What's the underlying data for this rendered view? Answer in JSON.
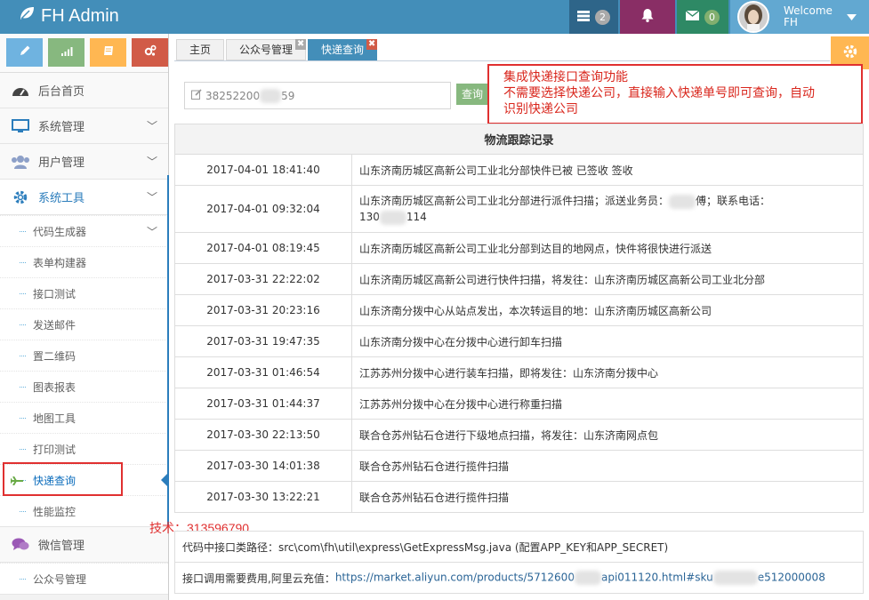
{
  "app": {
    "title": "FH Admin"
  },
  "navbar": {
    "tasks_count": "2",
    "messages_count": "0",
    "welcome_label": "Welcome",
    "user_name": "FH"
  },
  "colors": {
    "navbar": "#438eb9",
    "sidebar_active": "#2b7dbc",
    "annotation_red": "#e03030"
  },
  "sidebar": {
    "shortcuts": [
      "pencil-icon",
      "signal-icon",
      "book-icon",
      "cogs-icon"
    ],
    "menu": [
      {
        "label": "后台首页",
        "icon": "tachometer-icon"
      },
      {
        "label": "系统管理",
        "icon": "desktop-icon"
      },
      {
        "label": "用户管理",
        "icon": "users-icon"
      },
      {
        "label": "系统工具",
        "icon": "cog-icon"
      }
    ],
    "tools": [
      "代码生成器",
      "表单构建器",
      "接口测试",
      "发送邮件",
      "置二维码",
      "图表报表",
      "地图工具",
      "打印测试",
      "快递查询",
      "性能监控"
    ],
    "wechat": {
      "label": "微信管理",
      "icon": "comments-icon"
    },
    "wechat_sub": [
      "公众号管理"
    ]
  },
  "tabs": [
    {
      "label": "主页"
    },
    {
      "label": "公众号管理"
    },
    {
      "label": "快递查询"
    }
  ],
  "search": {
    "value_prefix": "38252200",
    "value_suffix": "59",
    "button": "查询"
  },
  "callout": {
    "line1": "集成快递接口查询功能",
    "line2": "不需要选择快递公司，直接输入快递单号即可查询，自动",
    "line3": "识别快递公司"
  },
  "table": {
    "header": "物流跟踪记录",
    "rows": [
      {
        "time": "2017-04-01 18:41:40",
        "desc": "山东济南历城区高新公司工业北分部快件已被 已签收 签收"
      },
      {
        "time": "2017-04-01 09:32:04",
        "desc_a": "山东济南历城区高新公司工业北分部进行派件扫描；派送业务员：",
        "desc_b": "傅；联系电话：",
        "phone_a": "130",
        "phone_b": "114"
      },
      {
        "time": "2017-04-01 08:19:45",
        "desc": "山东济南历城区高新公司工业北分部到达目的地网点，快件将很快进行派送"
      },
      {
        "time": "2017-03-31 22:22:02",
        "desc": "山东济南历城区高新公司进行快件扫描，将发往：山东济南历城区高新公司工业北分部"
      },
      {
        "time": "2017-03-31 20:23:16",
        "desc": "山东济南分拨中心从站点发出，本次转运目的地：山东济南历城区高新公司"
      },
      {
        "time": "2017-03-31 19:47:35",
        "desc": "山东济南分拨中心在分拨中心进行卸车扫描"
      },
      {
        "time": "2017-03-31 01:46:54",
        "desc": "江苏苏州分拨中心进行装车扫描，即将发往：山东济南分拨中心"
      },
      {
        "time": "2017-03-31 01:44:37",
        "desc": "江苏苏州分拨中心在分拨中心进行称重扫描"
      },
      {
        "time": "2017-03-30 22:13:50",
        "desc": "联合仓苏州钻石仓进行下级地点扫描，将发往：山东济南网点包"
      },
      {
        "time": "2017-03-30 14:01:38",
        "desc": "联合仓苏州钻石仓进行揽件扫描"
      },
      {
        "time": "2017-03-30 13:22:21",
        "desc": "联合仓苏州钻石仓进行揽件扫描"
      }
    ]
  },
  "tech_note": "技术：313596790",
  "footer": {
    "path_text": "代码中接口类路径：src\\com\\fh\\util\\express\\GetExpressMsg.java (配置APP_KEY和APP_SECRET)",
    "fee_label": "接口调用需要费用,阿里云充值：",
    "url_a": "https://market.aliyun.com/products/5712600",
    "url_b": "api011120.html#sku",
    "url_c": "e512000008"
  }
}
